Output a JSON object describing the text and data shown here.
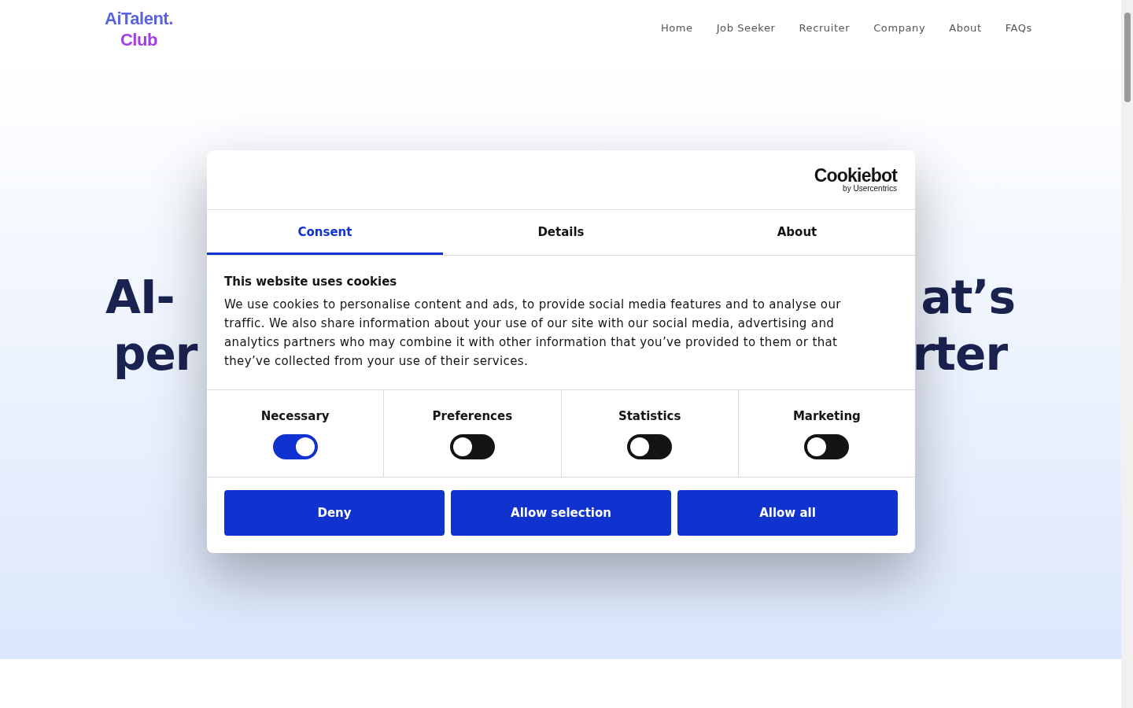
{
  "logo": {
    "line1": "AiTalent.",
    "line2": "Club"
  },
  "nav": [
    "Home",
    "Job Seeker",
    "Recruiter",
    "Company",
    "About",
    "FAQs"
  ],
  "hero": {
    "lines": [
      {
        "left": "AI-",
        "right": "at’s"
      },
      {
        "left": "per",
        "right": "rter"
      }
    ]
  },
  "cookie_dialog": {
    "brand": {
      "name": "Cookiebot",
      "byline": "by Usercentrics"
    },
    "tabs": [
      {
        "label": "Consent",
        "selected": true
      },
      {
        "label": "Details",
        "selected": false
      },
      {
        "label": "About",
        "selected": false
      }
    ],
    "heading": "This website uses cookies",
    "body": "We use cookies to personalise content and ads, to provide social media features and to analyse our traffic. We also share information about your use of our site with our social media, advertising and analytics partners who may combine it with other information that you’ve provided to them or that they’ve collected from your use of their services.",
    "categories": [
      {
        "label": "Necessary",
        "on": true
      },
      {
        "label": "Preferences",
        "on": false
      },
      {
        "label": "Statistics",
        "on": false
      },
      {
        "label": "Marketing",
        "on": false
      }
    ],
    "buttons": [
      "Deny",
      "Allow selection",
      "Allow all"
    ]
  }
}
